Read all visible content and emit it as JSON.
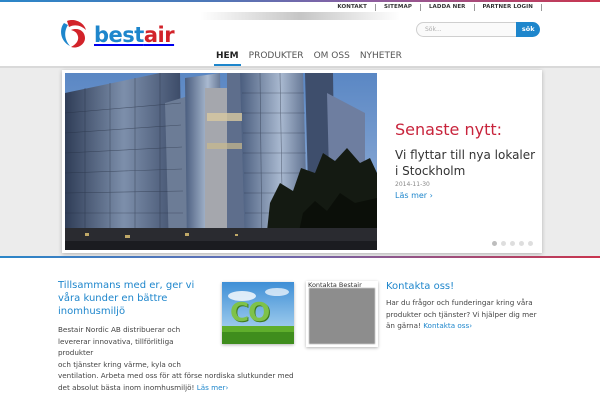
{
  "utility_nav": [
    "KONTAKT",
    "SITEMAP",
    "LADDA NER",
    "PARTNER LOGIN"
  ],
  "logo": {
    "part1": "best",
    "part2": "air"
  },
  "search": {
    "placeholder": "Sök...",
    "button_label": "sök"
  },
  "main_nav": [
    {
      "label": "HEM",
      "active": true
    },
    {
      "label": "PRODUKTER",
      "active": false
    },
    {
      "label": "OM OSS",
      "active": false
    },
    {
      "label": "NYHETER",
      "active": false
    }
  ],
  "hero": {
    "news_heading": "Senaste nytt:",
    "news_title": "Vi flyttar till nya lokaler i Stockholm",
    "news_date": "2014-11-30",
    "read_more": "Läs mer",
    "slide_count": 5,
    "active_slide": 0
  },
  "intro": {
    "heading": "Tillsammans med er, ger vi våra kunder en bättre inomhusmiljö",
    "line1": "Bestair Nordic AB distribuerar och",
    "line2": "levererar innovativa, tillförlitliga produkter",
    "line3": "och tjänster kring värme, kyla och",
    "line4": "ventilation. Arbeta med oss för att förse nordiska slutkunder med",
    "line5": "det absolut bästa inom inomhusmiljö!",
    "read_more": "Läs mer"
  },
  "thumbnails": {
    "co2_text": "CO",
    "contact_caption": "Kontakta Bestair"
  },
  "contact": {
    "heading": "Kontakta oss!",
    "text": "Har du frågor och funderingar kring våra produkter och tjänster? Vi hjälper dig mer än gärna!",
    "link": "Kontakta oss"
  },
  "colors": {
    "brand_blue": "#1e86cc",
    "brand_red": "#d2232a",
    "news_red": "#c8243c"
  }
}
